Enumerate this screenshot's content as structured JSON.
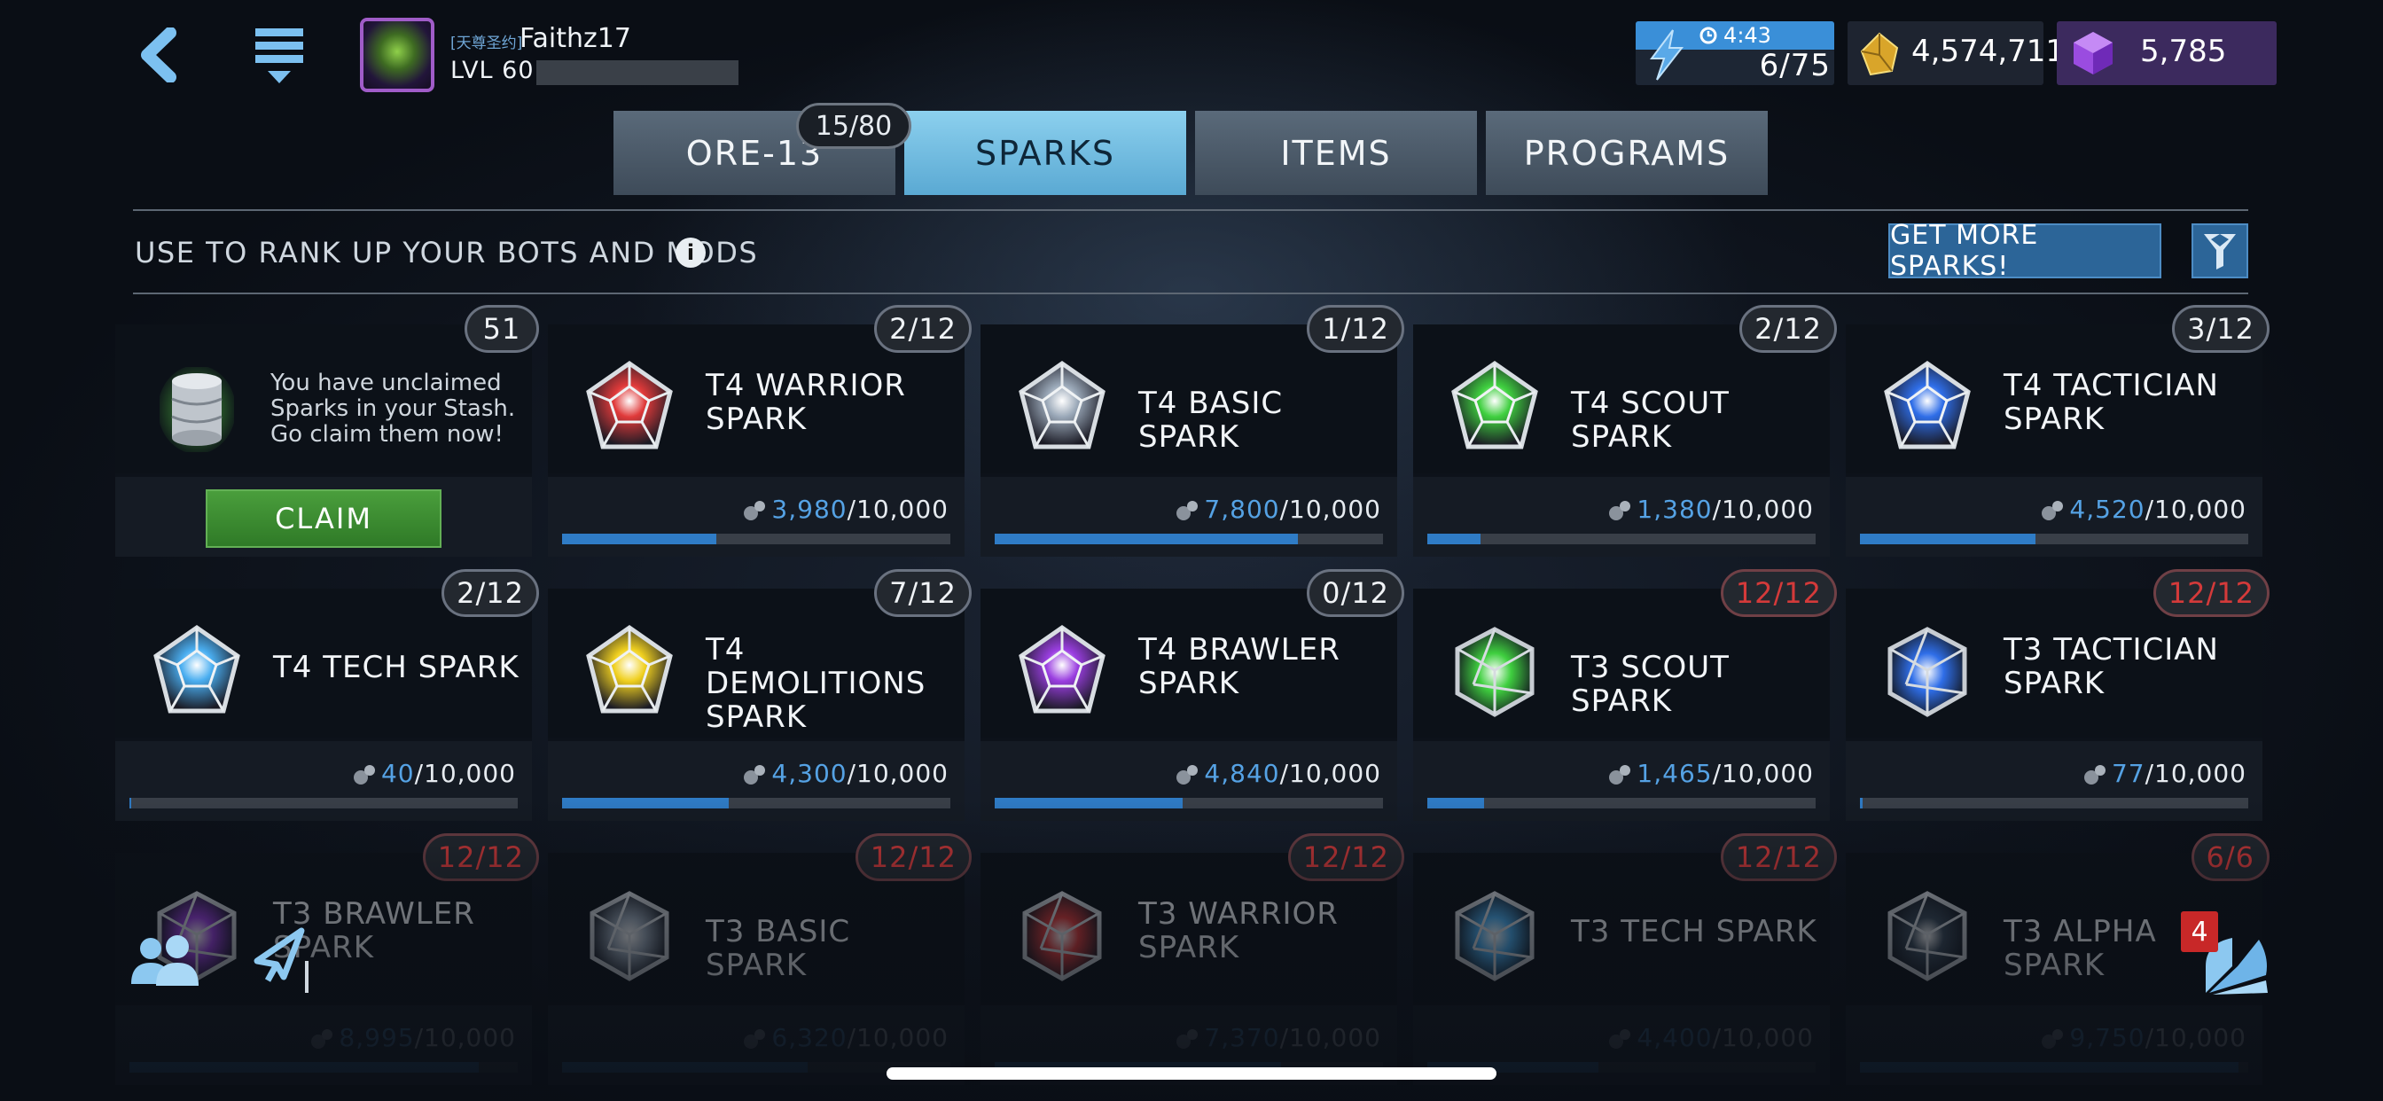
{
  "player": {
    "tag": "[天尊圣约]",
    "name": "Faithz17",
    "level": "LVL 60"
  },
  "currencies": {
    "energy_timer": "4:43",
    "energy": "6/75",
    "gold": "4,574,711",
    "gems": "5,785"
  },
  "tabs": [
    {
      "label": "ORE-13",
      "active": false
    },
    {
      "label": "SPARKS",
      "active": true
    },
    {
      "label": "ITEMS",
      "active": false
    },
    {
      "label": "PROGRAMS",
      "active": false
    }
  ],
  "tab_badge": "15/80",
  "subtitle": "USE TO RANK UP YOUR BOTS AND MODS",
  "info_glyph": "i",
  "get_more_label": "GET MORE SPARKS!",
  "stash": {
    "count": "51",
    "message": "You have unclaimed Sparks in your Stash. Go claim them now!",
    "claim_label": "CLAIM"
  },
  "sparks": [
    {
      "name": "T4 WARRIOR SPARK",
      "rank": "2/12",
      "current": "3,980",
      "max": "/10,000",
      "progress": 0.398,
      "color": "#e03a3a",
      "maxed": false
    },
    {
      "name": "T4 BASIC SPARK",
      "rank": "1/12",
      "current": "7,800",
      "max": "/10,000",
      "progress": 0.78,
      "color": "#9aa8b8",
      "maxed": false
    },
    {
      "name": "T4 SCOUT SPARK",
      "rank": "2/12",
      "current": "1,380",
      "max": "/10,000",
      "progress": 0.138,
      "color": "#3fcf3f",
      "maxed": false
    },
    {
      "name": "T4 TACTICIAN SPARK",
      "rank": "3/12",
      "current": "4,520",
      "max": "/10,000",
      "progress": 0.452,
      "color": "#2f6ee8",
      "maxed": false
    },
    {
      "name": "T4 TECH SPARK",
      "rank": "2/12",
      "current": "40",
      "max": "/10,000",
      "progress": 0.004,
      "color": "#4aaef0",
      "maxed": false
    },
    {
      "name": "T4 DEMOLITIONS SPARK",
      "rank": "7/12",
      "current": "4,300",
      "max": "/10,000",
      "progress": 0.43,
      "color": "#f0d020",
      "maxed": false
    },
    {
      "name": "T4 BRAWLER SPARK",
      "rank": "0/12",
      "current": "4,840",
      "max": "/10,000",
      "progress": 0.484,
      "color": "#9a3ee0",
      "maxed": false
    },
    {
      "name": "T3 SCOUT SPARK",
      "rank": "12/12",
      "current": "1,465",
      "max": "/10,000",
      "progress": 0.1465,
      "color": "#3fcf3f",
      "maxed": true
    },
    {
      "name": "T3 TACTICIAN SPARK",
      "rank": "12/12",
      "current": "77",
      "max": "/10,000",
      "progress": 0.0077,
      "color": "#2f6ee8",
      "maxed": true
    },
    {
      "name": "T3 BRAWLER SPARK",
      "rank": "12/12",
      "current": "8,995",
      "max": "/10,000",
      "progress": 0.8995,
      "color": "#9a3ee0",
      "maxed": true
    },
    {
      "name": "T3 BASIC SPARK",
      "rank": "12/12",
      "current": "6,320",
      "max": "/10,000",
      "progress": 0.632,
      "color": "#9aa8b8",
      "maxed": true
    },
    {
      "name": "T3 WARRIOR SPARK",
      "rank": "12/12",
      "current": "7,370",
      "max": "/10,000",
      "progress": 0.737,
      "color": "#e03a3a",
      "maxed": true
    },
    {
      "name": "T3 TECH SPARK",
      "rank": "12/12",
      "current": "4,400",
      "max": "/10,000",
      "progress": 0.44,
      "color": "#4aaef0",
      "maxed": true
    },
    {
      "name": "T3 ALPHA SPARK",
      "rank": "6/6",
      "current": "9,750",
      "max": "/10,000",
      "progress": 0.975,
      "color": "#3a4a5a",
      "maxed": true
    }
  ],
  "notification_count": "4",
  "icons": {
    "back": "chevron-left-icon",
    "menu": "menu-icon",
    "energy": "lightning-bolt-icon",
    "timer": "clock-icon",
    "gold": "gold-ore-icon",
    "gems": "gem-cube-icon",
    "filter": "filter-gem-icon",
    "friends": "friends-icon",
    "rocket": "rocket-icon",
    "progress": "spark-progress-icon"
  }
}
